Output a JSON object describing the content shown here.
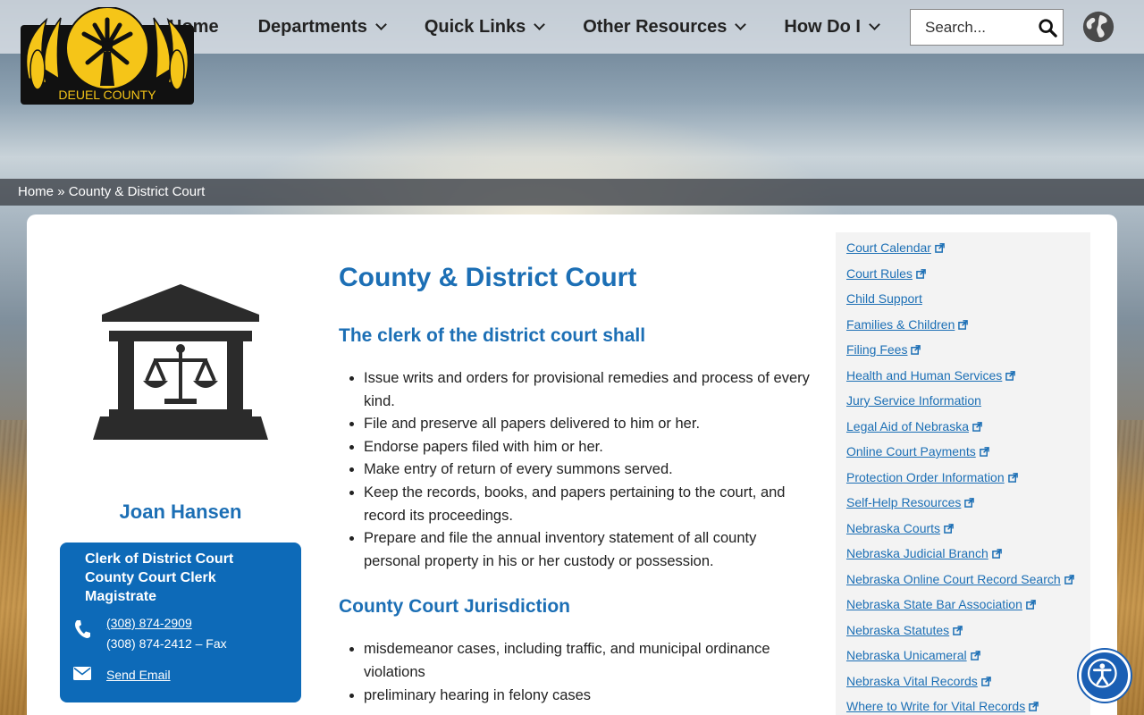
{
  "header": {
    "logo_text": "DEUEL COUNTY",
    "nav": [
      {
        "label": "Home",
        "has_dropdown": false
      },
      {
        "label": "Departments",
        "has_dropdown": true
      },
      {
        "label": "Quick Links",
        "has_dropdown": true
      },
      {
        "label": "Other Resources",
        "has_dropdown": true
      },
      {
        "label": "How Do I",
        "has_dropdown": true
      }
    ],
    "search_placeholder": "Search...",
    "search_icon": "magnifier-icon",
    "language_icon": "globe-icon"
  },
  "breadcrumb": {
    "home": "Home",
    "separator": "»",
    "current": "County & District Court"
  },
  "profile": {
    "icon": "courthouse-scales-icon",
    "name": "Joan Hansen",
    "titles": [
      "Clerk of District Court",
      "County Court Clerk",
      "Magistrate"
    ],
    "phone": "(308) 874-2909",
    "fax": "(308) 874-2412 – Fax",
    "email_label": "Send Email"
  },
  "main": {
    "title": "County & District Court",
    "section1_heading": "The clerk of the district court shall",
    "section1_items": [
      "Issue writs and orders for provisional remedies and process of every kind.",
      "File and preserve all papers delivered to him or her.",
      "Endorse papers filed with him or her.",
      "Make entry of return of every summons served.",
      "Keep the records, books, and papers pertaining to the court, and record its proceedings.",
      "Prepare and file the annual inventory statement of all county personal property in his or her custody or possession."
    ],
    "section2_heading": "County Court Jurisdiction",
    "section2_items": [
      "misdemeanor cases, including traffic, and municipal ordinance violations",
      "preliminary hearing in felony cases"
    ]
  },
  "sidebar_links": [
    {
      "label": "Court Calendar",
      "external": true
    },
    {
      "label": "Court Rules",
      "external": true
    },
    {
      "label": "Child Support",
      "external": false
    },
    {
      "label": "Families & Children",
      "external": true
    },
    {
      "label": "Filing Fees",
      "external": true
    },
    {
      "label": "Health and Human Services",
      "external": true
    },
    {
      "label": "Jury Service Information",
      "external": false
    },
    {
      "label": "Legal Aid of Nebraska",
      "external": true
    },
    {
      "label": "Online Court Payments",
      "external": true
    },
    {
      "label": "Protection Order Information",
      "external": true
    },
    {
      "label": "Self-Help Resources",
      "external": true
    },
    {
      "label": "Nebraska Courts",
      "external": true
    },
    {
      "label": "Nebraska Judicial Branch",
      "external": true
    },
    {
      "label": "Nebraska Online Court Record Search",
      "external": true
    },
    {
      "label": "Nebraska State Bar Association",
      "external": true
    },
    {
      "label": "Nebraska Statutes",
      "external": true
    },
    {
      "label": "Nebraska Unicameral",
      "external": true
    },
    {
      "label": "Nebraska Vital Records",
      "external": true
    },
    {
      "label": "Where to Write for Vital Records",
      "external": true
    }
  ],
  "accessibility_icon": "accessibility-icon",
  "colors": {
    "accent_blue": "#1c6fb5",
    "info_box_blue": "#0d6ab8",
    "logo_gold": "#f5c518"
  }
}
